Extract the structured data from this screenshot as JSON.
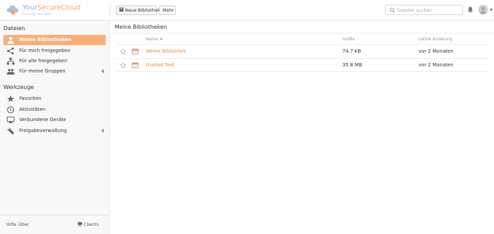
{
  "header": {
    "logo_your": "Your",
    "logo_brand": "SecureCloud",
    "logo_tagline": "Securely. Your Data.",
    "new_library_label": "Neue Bibliothek",
    "more_label": "Mehr",
    "search_placeholder": "Dateien suchen"
  },
  "sidebar": {
    "files_title": "Dateien",
    "files_items": [
      {
        "label": "Meine Bibliotheken",
        "icon": "user-icon",
        "active": true
      },
      {
        "label": "Für mich freigegeben",
        "icon": "share-icon"
      },
      {
        "label": "Für alle freigegeben",
        "icon": "org-icon"
      },
      {
        "label": "Für meine Gruppen",
        "icon": "group-icon",
        "expandable": true
      }
    ],
    "tools_title": "Werkzeuge",
    "tools_items": [
      {
        "label": "Favoriten",
        "icon": "star-icon"
      },
      {
        "label": "Aktivitäten",
        "icon": "clock-icon"
      },
      {
        "label": "Verbundene Geräte",
        "icon": "monitor-icon"
      },
      {
        "label": "Freigabeverwaltung",
        "icon": "wrench-icon",
        "expandable": true
      }
    ],
    "footer": {
      "help": "Hilfe",
      "about": "Über",
      "clients": "Clients"
    }
  },
  "main": {
    "title": "Meine Bibliotheken",
    "columns": {
      "name": "Name",
      "size": "Größe",
      "modified": "Letzte Änderung"
    },
    "rows": [
      {
        "name": "Meine Bibliothek",
        "size": "74.7 KB",
        "modified": "vor 2 Monaten"
      },
      {
        "name": "trusted Test",
        "size": "35.8 MB",
        "modified": "vor 2 Monaten"
      }
    ]
  },
  "colors": {
    "accent": "#f9ae78",
    "link": "#f08a3c",
    "logo_blue": "#7fb2e6"
  }
}
